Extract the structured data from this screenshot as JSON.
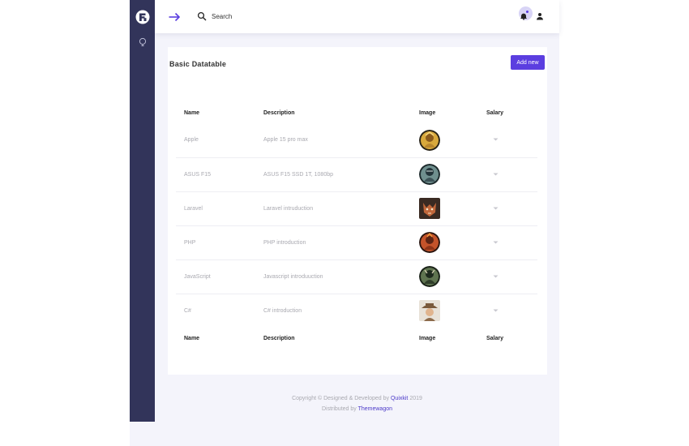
{
  "topbar": {
    "search_placeholder": "Search"
  },
  "card": {
    "title": "Basic Datatable",
    "add_label": "Add new"
  },
  "table": {
    "columns": [
      "Name",
      "Description",
      "Image",
      "Salary"
    ],
    "rows": [
      {
        "name": "Apple",
        "description": "Apple 15 pro max",
        "image": "golden-warrior-avatar"
      },
      {
        "name": "ASUS F15",
        "description": "ASUS F15 SSD 1T, 1080bp",
        "image": "armored-knight-avatar"
      },
      {
        "name": "Laravel",
        "description": "Laravel intruduction",
        "image": "fox-character-avatar"
      },
      {
        "name": "PHP",
        "description": "PHP introduction",
        "image": "fire-warrior-avatar"
      },
      {
        "name": "JavaScript",
        "description": "Javascript introduuction",
        "image": "dark-warrior-avatar"
      },
      {
        "name": "C#",
        "description": "C# introduction",
        "image": "cowboy-character-avatar"
      }
    ]
  },
  "footer": {
    "line1_prefix": "Copyright © Designed & Developed by",
    "line1_link": "Quixkit",
    "line1_suffix": "2019",
    "line2_prefix": "Distributed by",
    "line2_link": "Themewagon"
  },
  "colors": {
    "sidebar": "#32345a",
    "accent": "#5b3ee0",
    "background": "#f4f4fb"
  }
}
